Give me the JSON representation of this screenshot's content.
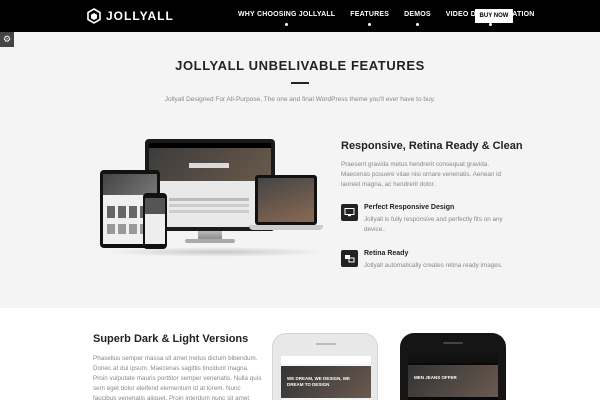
{
  "nav": {
    "logo": "JOLLYALL",
    "links": [
      "WHY CHOOSING JOLLYALL",
      "FEATURES",
      "DEMOS",
      "VIDEO DOCUMENTATION"
    ],
    "buy": "BUY NOW"
  },
  "features": {
    "title": "JOLLYALL UNBELIVABLE FEATURES",
    "subtitle": "Jollyall Designed For All-Purpose, The one and final WordPress theme you'll ever have to buy.",
    "mockup": {
      "monitor_caption": "WELCOME TO JOLLYALL",
      "monitor_section": "FEATURED WORKS",
      "laptop_caption": "WE DREAM"
    },
    "heading": "Responsive, Retina Ready & Clean",
    "text": "Praesent gravida metus hendrerit consequat gravida. Maecenas posuere vitae nisi ornare venenatis. Aenean id laoreet magna, ac hendrerit dolor.",
    "items": [
      {
        "title": "Perfect Responsive Design",
        "desc": "Jollyall is fully responsive and perfectly fits on any device..",
        "icon": "monitor-icon"
      },
      {
        "title": "Retina Ready",
        "desc": "Jollyall automatically creates retina ready images.",
        "icon": "retina-icon"
      }
    ]
  },
  "versions": {
    "title": "Superb Dark & Light Versions",
    "text": "Phasellus semper massa sit amet metus dictum bibendum. Donec at dui ipsum. Maecenas sagittis tincidunt magna. Proin vulputate mauris porttitor semper venenatis. Nulla quis sem eget dolor eleifend elementum id at lorem. Nunc faucibus venenatis aliquet. Proin interdum nunc sit amet",
    "light_caption": "WE DREAM, WE DESIGN, WE DREAM TO DESIGN",
    "dark_caption": "MEN JEANS OFFER"
  }
}
